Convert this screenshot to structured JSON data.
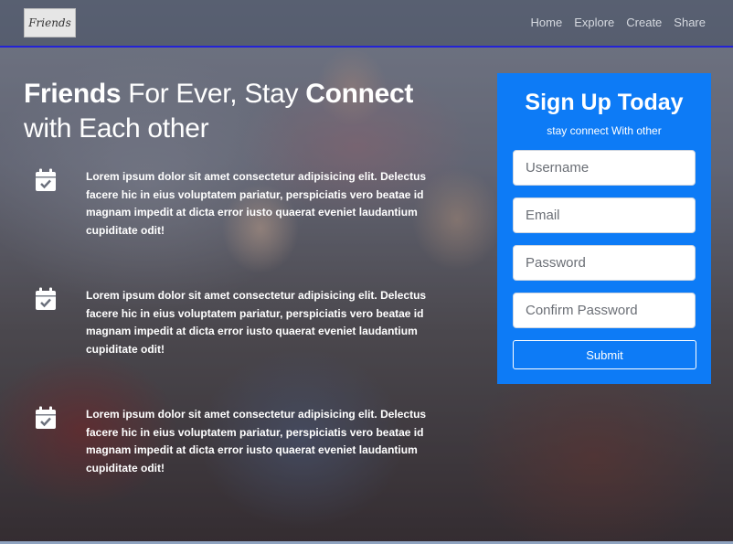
{
  "brand": {
    "logo_text": "Friends"
  },
  "nav": {
    "links": [
      "Home",
      "Explore",
      "Create",
      "Share"
    ]
  },
  "hero": {
    "headline_bold_1": "Friends",
    "headline_1": " For Ever, Stay ",
    "headline_bold_2": "Connect",
    "headline_2": "with Each other"
  },
  "features": [
    {
      "icon": "calendar-check-icon",
      "text": "Lorem ipsum dolor sit amet consectetur adipisicing elit. Delectus facere hic in eius voluptatem pariatur, perspiciatis vero beatae id magnam impedit at dicta error iusto quaerat eveniet laudantium cupiditate odit!"
    },
    {
      "icon": "calendar-check-icon",
      "text": "Lorem ipsum dolor sit amet consectetur adipisicing elit. Delectus facere hic in eius voluptatem pariatur, perspiciatis vero beatae id magnam impedit at dicta error iusto quaerat eveniet laudantium cupiditate odit!"
    },
    {
      "icon": "calendar-check-icon",
      "text": "Lorem ipsum dolor sit amet consectetur adipisicing elit. Delectus facere hic in eius voluptatem pariatur, perspiciatis vero beatae id magnam impedit at dicta error iusto quaerat eveniet laudantium cupiditate odit!"
    }
  ],
  "signup": {
    "title": "Sign Up Today",
    "subtitle": "stay connect With other",
    "username_placeholder": "Username",
    "email_placeholder": "Email",
    "password_placeholder": "Password",
    "confirm_placeholder": "Confirm Password",
    "submit_label": "Submit"
  },
  "colors": {
    "accent": "#0d7bf6",
    "nav_border": "#2323d6"
  }
}
